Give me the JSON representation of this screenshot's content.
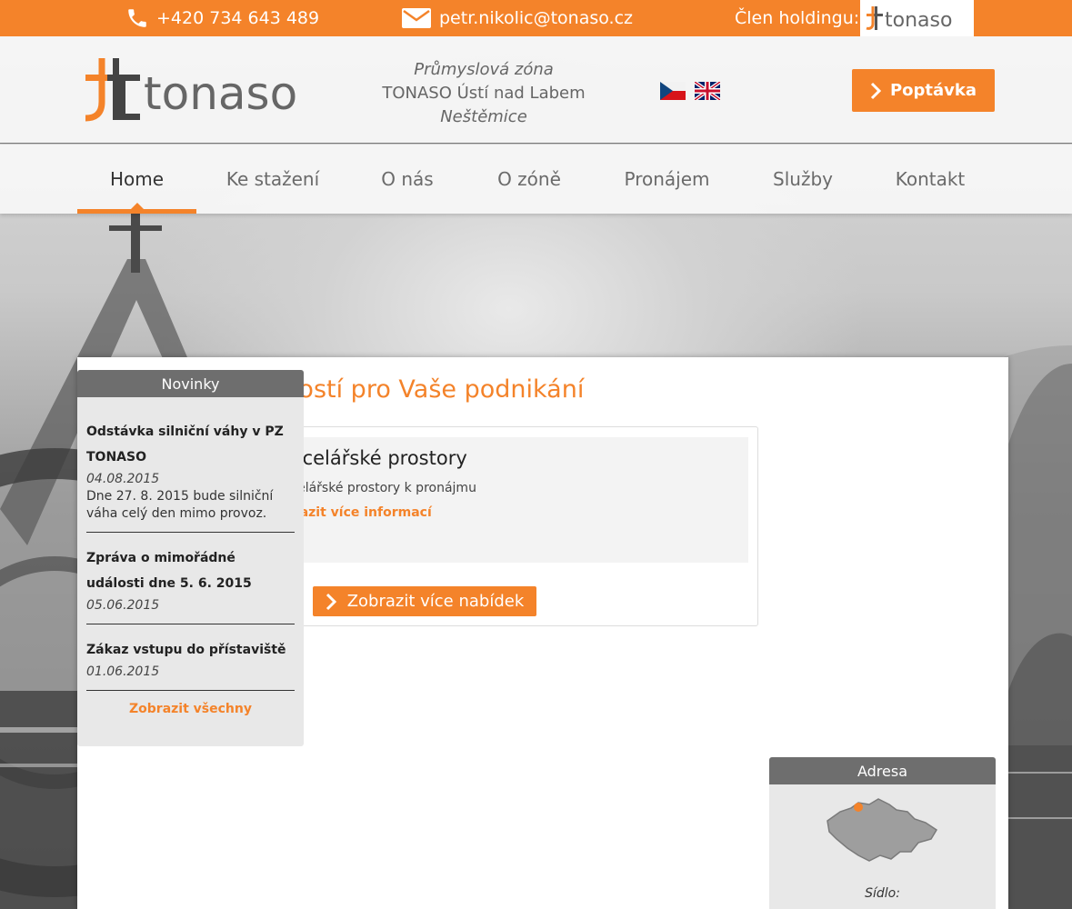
{
  "topbar": {
    "phone": "+420 734 643 489",
    "email": "petr.nikolic@tonaso.cz",
    "member_label": "Člen holdingu:",
    "member_logo_text": "tonaso",
    "phone_icon": "phone-icon",
    "email_icon": "envelope-icon"
  },
  "header": {
    "logo_text": "tonaso",
    "address_line1": "Průmyslová zóna",
    "address_line2": "TONASO Ústí nad Labem",
    "address_line3": "Neštěmice",
    "languages": [
      "cs",
      "en"
    ],
    "inquiry_button": "Poptávka"
  },
  "nav": {
    "items": [
      {
        "label": "Home",
        "active": true
      },
      {
        "label": "Ke stažení",
        "active": false
      },
      {
        "label": "O nás",
        "active": false
      },
      {
        "label": "O zóně",
        "active": false
      },
      {
        "label": "Pronájem",
        "active": false
      },
      {
        "label": "Služby",
        "active": false
      },
      {
        "label": "Kontakt",
        "active": false
      }
    ]
  },
  "main": {
    "title": "Nabídka nemovitostí pro Vaše podnikání",
    "offers": [
      {
        "title": "Kancelářské prostory",
        "description": "Kancelářské prostory k pronájmu",
        "link": "Zobrazit více informací"
      }
    ],
    "more_offers_button": "Zobrazit více nabídek"
  },
  "sidebar": {
    "news_heading": "Novinky",
    "news": [
      {
        "title": "Odstávka silniční váhy v PZ TONASO",
        "date": "04.08.2015",
        "text": "Dne 27. 8. 2015 bude silniční váha celý den mimo provoz."
      },
      {
        "title": "Zpráva o mimořádné události dne 5. 6. 2015",
        "date": "05.06.2015",
        "text": ""
      },
      {
        "title": "Zákaz vstupu do přístaviště",
        "date": "01.06.2015",
        "text": ""
      }
    ],
    "all_news_link": "Zobrazit všechny",
    "address_heading": "Adresa",
    "address_label": "Sídlo:"
  },
  "colors": {
    "accent": "#f4832a",
    "sidebar_head": "#6e6e6e",
    "sidebar_bg": "#e8e8e8"
  }
}
